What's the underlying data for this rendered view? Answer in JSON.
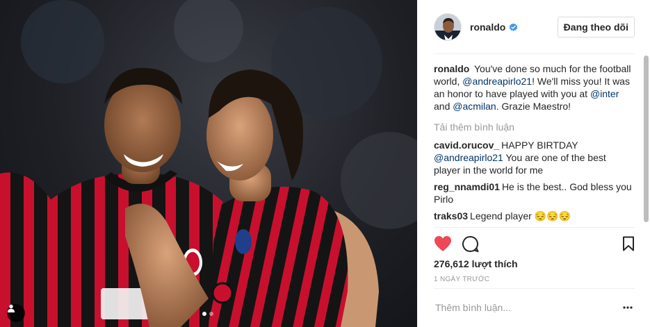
{
  "post": {
    "image_alt": "",
    "carousel_dots": 2,
    "carousel_active": 1,
    "tag_icon": "person-icon"
  },
  "header": {
    "username": "ronaldo",
    "verified_icon": "verified-badge-icon",
    "follow_label": "Đang theo dõi"
  },
  "caption": {
    "user": "ronaldo",
    "parts": [
      {
        "text": "You've done so much for the football world, ",
        "mention": false
      },
      {
        "text": "@andreapirlo21",
        "mention": true
      },
      {
        "text": "! We'll miss you! It was an honor to have played with you at ",
        "mention": false
      },
      {
        "text": "@inter",
        "mention": true
      },
      {
        "text": " and ",
        "mention": false
      },
      {
        "text": "@acmilan",
        "mention": true
      },
      {
        "text": ". Grazie Maestro!",
        "mention": false
      }
    ]
  },
  "load_more_label": "Tải thêm bình luận",
  "comments": [
    {
      "user": "cavid.orucov_",
      "parts": [
        {
          "text": "HAPPY BIRTDAY ",
          "mention": false
        },
        {
          "text": "@andreapirlo21",
          "mention": true
        },
        {
          "text": " You are one of the best player in the world for me",
          "mention": false
        }
      ]
    },
    {
      "user": "reg_nnamdi01",
      "parts": [
        {
          "text": "He is the best.. God bless you Pirlo",
          "mention": false
        }
      ]
    },
    {
      "user": "traks03",
      "parts": [
        {
          "text": "Legend player 😔😔😔",
          "mention": false
        }
      ]
    }
  ],
  "actions": {
    "like_icon": "heart-filled-icon",
    "comment_icon": "comment-bubble-icon",
    "save_icon": "bookmark-icon"
  },
  "likes": {
    "count": "276,612",
    "label": "lượt thích"
  },
  "timestamp": "1 NGÀY TRƯỚC",
  "comment_box": {
    "placeholder": "Thêm bình luận...",
    "more_icon": "ellipsis-icon"
  },
  "colors": {
    "heart": "#ed4956",
    "mention": "#003569",
    "verified": "#3897f0",
    "milan_red": "#c8102e"
  }
}
